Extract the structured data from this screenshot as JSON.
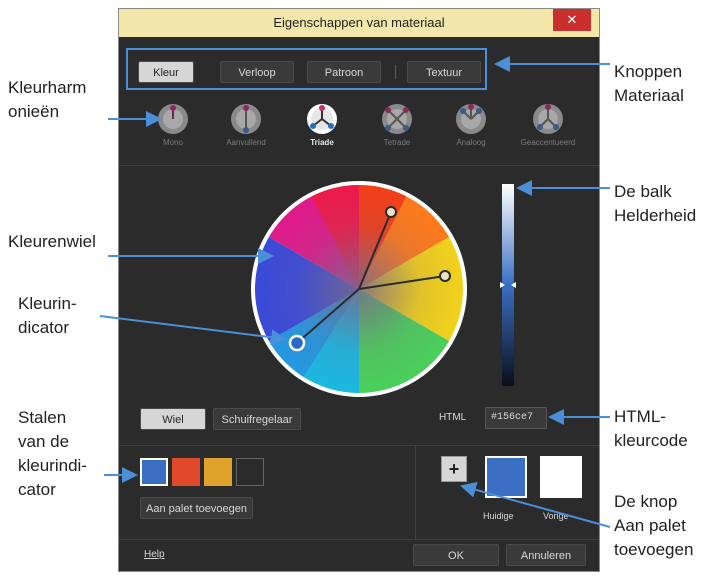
{
  "dialog": {
    "title": "Eigenschappen van materiaal",
    "close_glyph": "✕"
  },
  "tabs": [
    {
      "label": "Kleur",
      "active": true
    },
    {
      "label": "Verloop",
      "active": false
    },
    {
      "label": "Patroon",
      "active": false
    },
    {
      "label": "Textuur",
      "active": false
    }
  ],
  "harmonies": [
    {
      "label": "Mono",
      "selected": false
    },
    {
      "label": "Aanvullend",
      "selected": false
    },
    {
      "label": "Triade",
      "selected": true
    },
    {
      "label": "Tetrade",
      "selected": false
    },
    {
      "label": "Analoog",
      "selected": false
    },
    {
      "label": "Geaccentueerd",
      "selected": false
    }
  ],
  "mode_buttons": {
    "wheel": "Wiel",
    "slider": "Schuifregelaar"
  },
  "html": {
    "label": "HTML",
    "value": "#156ce7"
  },
  "swatches": [
    "#3a6fc4",
    "#e04a2a",
    "#e0a22a",
    "#2b2b2b"
  ],
  "add_to_palette": "Aan palet toevoegen",
  "current_label": "Huidige",
  "previous_label": "Vorige",
  "current_color": "#3a6fc4",
  "previous_color": "#ffffff",
  "help": "Help",
  "ok": "OK",
  "cancel": "Annuleren",
  "plus": "+",
  "annotations": {
    "harmonies": [
      "Kleurharm",
      "onieën"
    ],
    "wheel": "Kleurenwiel",
    "indicator": [
      "Kleurin-",
      "dicator"
    ],
    "swatches": [
      "Stalen",
      "van de",
      "kleurindi-",
      "cator"
    ],
    "buttons": [
      "Knoppen",
      "Materiaal"
    ],
    "brightness": [
      "De balk",
      "Helderheid"
    ],
    "htmlcode": [
      "HTML-",
      "kleurcode"
    ],
    "addbutton": [
      "De knop",
      "Aan palet",
      "toevoegen"
    ]
  },
  "colors": {
    "accent": "#4a8fd8",
    "dialog_bg": "#2b2b2b",
    "title_bg": "#f2e6a8",
    "close_bg": "#c9302c"
  }
}
